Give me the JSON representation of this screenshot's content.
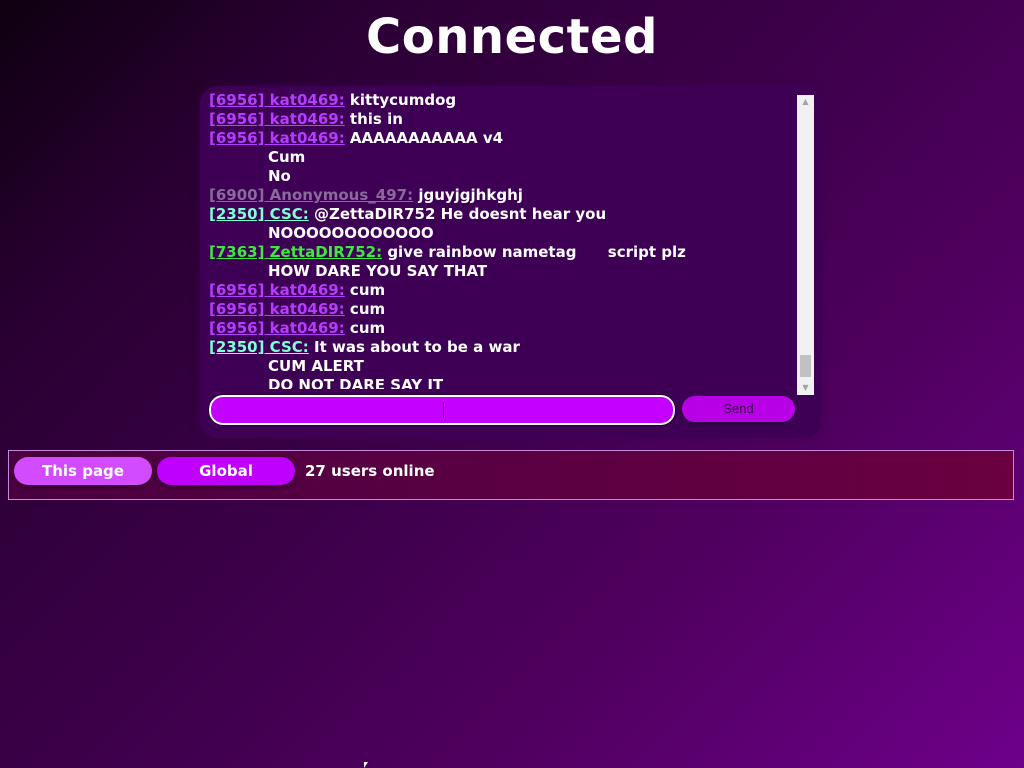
{
  "page": {
    "title": "Connected"
  },
  "chat": {
    "messages": [
      {
        "user": "[6956] kat0469:",
        "text": " kittycumdog",
        "color": "#b63cff"
      },
      {
        "user": "[6956] kat0469:",
        "text": " this in",
        "color": "#b63cff"
      },
      {
        "user": "[6956] kat0469:",
        "text": " AAAAAAAAAAA v4",
        "color": "#b63cff"
      },
      {
        "user": "",
        "text": "Cum",
        "color": ""
      },
      {
        "user": "",
        "text": "No",
        "color": ""
      },
      {
        "user": "[6900] Anonymous_497:",
        "text": " jguyjgjhkghj",
        "color": "#8a6a9a"
      },
      {
        "user": "[2350] CSC:",
        "text": " @ZettaDIR752 He doesnt hear you",
        "color": "#7fffd4"
      },
      {
        "user": "",
        "text": "NOOOOOOOOOOOO",
        "color": ""
      },
      {
        "user": "[7363] ZettaDIR752:",
        "text": " give rainbow nametag      script plz",
        "color": "#3fe83f"
      },
      {
        "user": "",
        "text": "HOW DARE YOU SAY THAT",
        "color": ""
      },
      {
        "user": "[6956] kat0469:",
        "text": " cum",
        "color": "#b63cff"
      },
      {
        "user": "[6956] kat0469:",
        "text": " cum",
        "color": "#b63cff"
      },
      {
        "user": "[6956] kat0469:",
        "text": " cum",
        "color": "#b63cff"
      },
      {
        "user": "[2350] CSC:",
        "text": " It was about to be a war",
        "color": "#7fffd4"
      },
      {
        "user": "",
        "text": "CUM ALERT",
        "color": ""
      },
      {
        "user": "",
        "text": "DO NOT DARE SAY IT",
        "color": ""
      }
    ],
    "input": {
      "value": ""
    },
    "send_label": "Send",
    "scroll_up_icon": "triangle-up",
    "scroll_down_icon": "triangle-down"
  },
  "online": {
    "this_page_label": "This page",
    "global_label": "Global",
    "count_text": "27 users online"
  },
  "colors": {
    "accent": "#c400ff",
    "panel": "#3d0055"
  }
}
